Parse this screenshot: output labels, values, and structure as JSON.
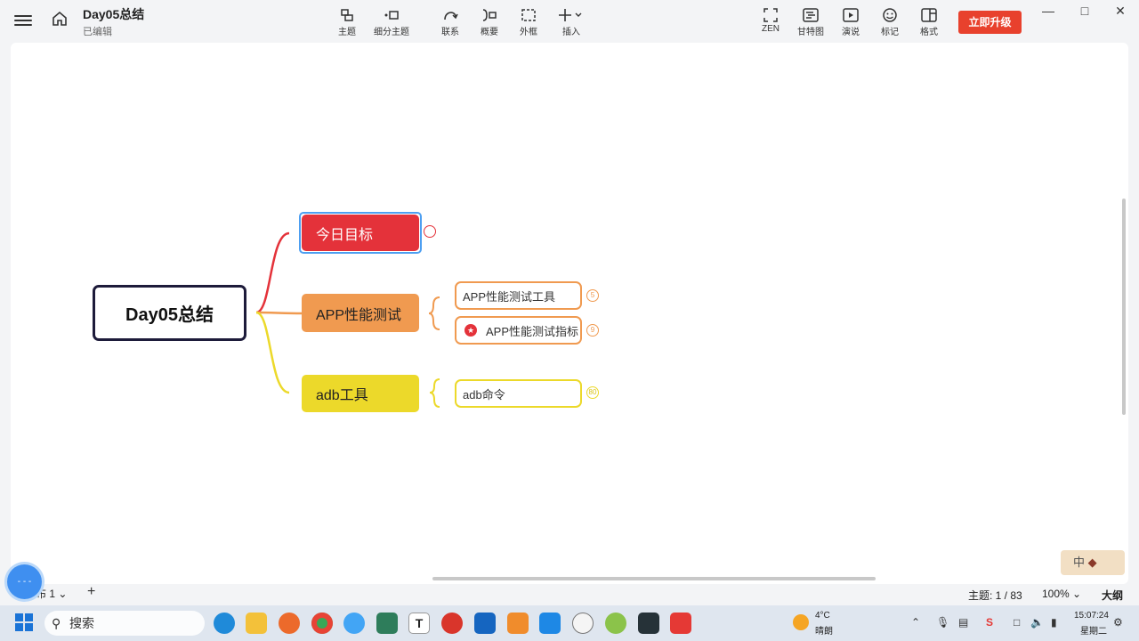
{
  "app": {
    "doc_title": "Day05总结",
    "doc_status": "已编辑",
    "upgrade_label": "立即升级"
  },
  "toolbar": {
    "topic": "主题",
    "subtopic": "细分主题",
    "relationship": "联系",
    "summary": "概要",
    "boundary": "外框",
    "insert": "插入",
    "zen": "ZEN",
    "gantt": "甘特图",
    "present": "演说",
    "marker": "标记",
    "format": "格式"
  },
  "mindmap": {
    "root": "Day05总结",
    "branches": [
      {
        "label": "今日目标",
        "color": "#e4323a"
      },
      {
        "label": "APP性能测试",
        "color": "#f09a50",
        "children": [
          {
            "label": "APP性能测试工具",
            "count": "5"
          },
          {
            "label": "APP性能测试指标",
            "count": "9",
            "marker": "star"
          }
        ]
      },
      {
        "label": "adb工具",
        "color": "#ecd92a",
        "children": [
          {
            "label": "adb命令",
            "count": "80"
          }
        ]
      }
    ]
  },
  "statusbar": {
    "sheet_tab": "布 1",
    "topic_count": "主题: 1 / 83",
    "zoom": "100%",
    "outline": "大纲"
  },
  "ime": {
    "label": "中"
  },
  "taskbar": {
    "search_placeholder": "搜索",
    "weather_temp": "4°C",
    "weather_desc": "晴朗",
    "time": "15:07:24",
    "date": "星期二"
  },
  "colors": {
    "accent": "#e8412d",
    "selection": "#4d9ff1",
    "root_border": "#1d1b3a"
  }
}
